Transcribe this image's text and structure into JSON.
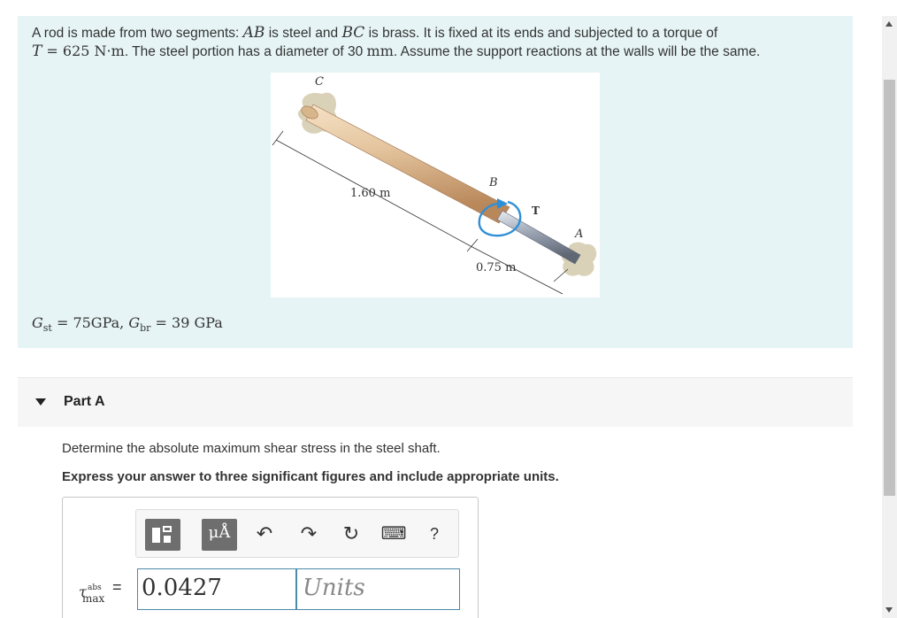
{
  "problem": {
    "text_1": "A rod is made from two segments: ",
    "seg_ab": "AB",
    "text_2": " is steel and ",
    "seg_bc": "BC",
    "text_3": " is brass. It is fixed at its ends and subjected to a torque of",
    "torque_sym": "T",
    "torque_eq": " = 625 N·m",
    "text_4": ". The steel portion has a diameter of 30 ",
    "dia_unit": "mm",
    "text_5": ". Assume the support reactions at the walls will be the same."
  },
  "figure": {
    "label_c": "C",
    "label_b": "B",
    "label_t": "T",
    "label_a": "A",
    "length_bc": "1.60 m",
    "length_ab": "0.75 m",
    "colors": {
      "brass": "#e3c39c",
      "steel": "#9aa3b2",
      "wall": "#d9d1b8",
      "torque_arrow": "#2f8fd6"
    }
  },
  "moduli": {
    "g_st_sym": "G",
    "g_st_sub": "st",
    "g_st_val": " = 75GPa, ",
    "g_br_sym": "G",
    "g_br_sub": "br",
    "g_br_val": " = 39 GPa"
  },
  "part": {
    "title": "Part A"
  },
  "question": {
    "prompt": "Determine the absolute maximum shear stress in the steel shaft.",
    "instruction": "Express your answer to three significant figures and include appropriate units."
  },
  "toolbar": {
    "units_label": "μÅ",
    "undo_icon": "↶",
    "redo_icon": "↷",
    "reset_icon": "↻",
    "keyboard_icon": "⌨",
    "help_icon": "?"
  },
  "answer": {
    "tau_sym": "τ",
    "tau_sup": "abs",
    "tau_sub": "max",
    "equals": "=",
    "value": "0.0427",
    "units_placeholder": "Units"
  }
}
